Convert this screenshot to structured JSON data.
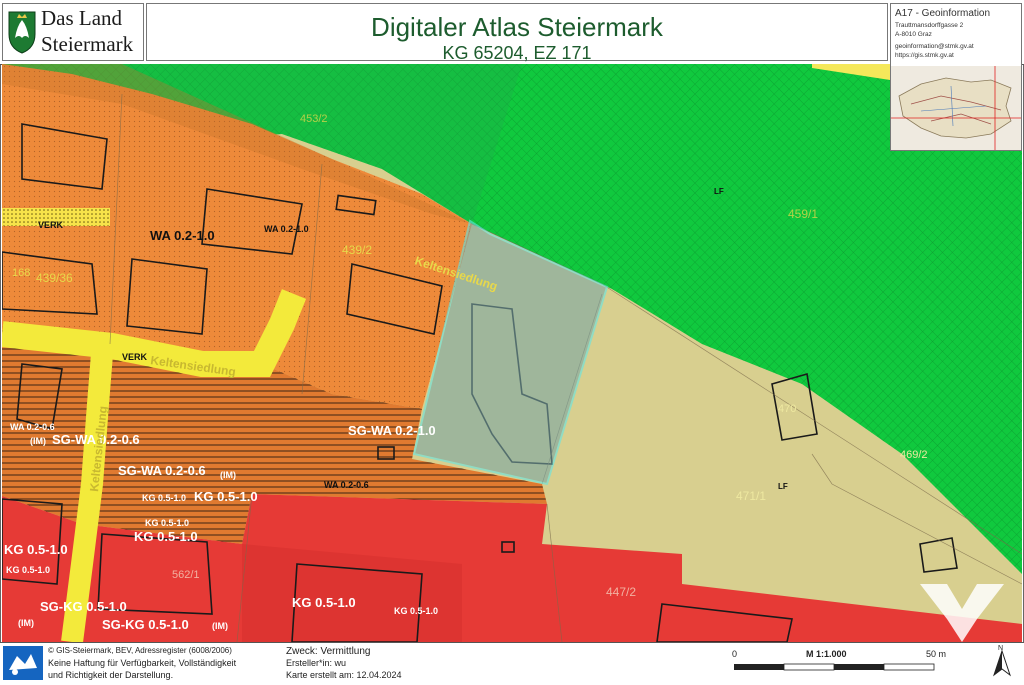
{
  "header": {
    "brand_line1": "Das Land",
    "brand_line2": "Steiermark",
    "title": "Digitaler Atlas Steiermark",
    "subtitle": "KG 65204, EZ 171"
  },
  "office": {
    "name": "A17 - Geoinformation",
    "street": "Trauttmansdorffgasse 2",
    "city": "A-8010 Graz",
    "email": "geoinformation@stmk.gv.at",
    "url": "https://gis.stmk.gv.at"
  },
  "map": {
    "zone_labels": [
      {
        "id": "wa-02-10-main",
        "text": "WA 0.2-1.0"
      },
      {
        "id": "wa-02-10-small",
        "text": "WA 0.2-1.0"
      },
      {
        "id": "verk-top",
        "text": "VERK"
      },
      {
        "id": "verk-road",
        "text": "VERK"
      },
      {
        "id": "wa-02-06",
        "text": "WA 0.2-0.6"
      },
      {
        "id": "im-1",
        "text": "(IM)"
      },
      {
        "id": "sg-wa-02-06",
        "text": "SG-WA 0.2-0.6"
      },
      {
        "id": "sg-wa-02-10",
        "text": "SG-WA 0.2-1.0"
      },
      {
        "id": "sg-wa-02-06-im",
        "text": "SG-WA 0.2-0.6"
      },
      {
        "id": "im-2",
        "text": "(IM)"
      },
      {
        "id": "wa-02-06-b",
        "text": "WA 0.2-0.6"
      },
      {
        "id": "kg-05-10-a",
        "text": "KG 0.5-1.0"
      },
      {
        "id": "kg-05-10-b",
        "text": "KG 0.5-1.0"
      },
      {
        "id": "kg-05-10-c",
        "text": "KG 0.5-1.0"
      },
      {
        "id": "kg-05-10-d",
        "text": "KG 0.5-1.0"
      },
      {
        "id": "kg-05-10-e",
        "text": "KG 0.5-1.0"
      },
      {
        "id": "kg-05-10-f",
        "text": "KG 0.5-1.0"
      },
      {
        "id": "kg-05-10-g",
        "text": "KG 0.5-1.0"
      },
      {
        "id": "kg-05-10-h",
        "text": "KG 0.5-1.0"
      },
      {
        "id": "sg-kg-05-10-a",
        "text": "SG-KG 0.5-1.0"
      },
      {
        "id": "im-3",
        "text": "(IM)"
      },
      {
        "id": "sg-kg-05-10-b",
        "text": "SG-KG 0.5-1.0"
      },
      {
        "id": "im-4",
        "text": "(IM)"
      },
      {
        "id": "lf-top",
        "text": "LF"
      },
      {
        "id": "lf-bottom",
        "text": "LF"
      }
    ],
    "parcel_labels": [
      {
        "id": "p-453-2",
        "text": "453/2"
      },
      {
        "id": "p-459-1",
        "text": "459/1"
      },
      {
        "id": "p-439-36",
        "text": "439/36"
      },
      {
        "id": "p-168",
        "text": "168"
      },
      {
        "id": "p-439-2",
        "text": "439/2"
      },
      {
        "id": "p-470",
        "text": "470"
      },
      {
        "id": "p-469-2",
        "text": "469/2"
      },
      {
        "id": "p-471-1",
        "text": "471/1"
      },
      {
        "id": "p-447-2",
        "text": "447/2"
      },
      {
        "id": "p-562-1",
        "text": "562/1"
      }
    ],
    "street_labels": [
      {
        "id": "street-keltensiedlung-a",
        "text": "Keltensiedlung"
      },
      {
        "id": "street-keltensiedlung-b",
        "text": "Keltensiedlung"
      },
      {
        "id": "street-keltensiedlung-c",
        "text": "Keltensiedlung"
      }
    ]
  },
  "footer": {
    "copyright": "© GIS-Steiermark, BEV, Adressregister (6008/2006)",
    "disclaimer1": "Keine Haftung für Verfügbarkeit, Vollständigkeit",
    "disclaimer2": "und Richtigkeit der Darstellung.",
    "purpose": "Zweck: Vermittlung",
    "creator": "Ersteller*in: wu",
    "created": "Karte erstellt am: 12.04.2024",
    "scale_zero": "0",
    "scale_ratio": "M 1:1.000",
    "scale_end": "50 m",
    "north_label": "N"
  },
  "colors": {
    "forest": "#10c93e",
    "residential": "#ee8a3a",
    "core": "#e63a36",
    "agri": "#d8cf8f",
    "road": "#f3ea3b",
    "highlight": "#62e6e6",
    "title_green": "#1d5c2e"
  }
}
